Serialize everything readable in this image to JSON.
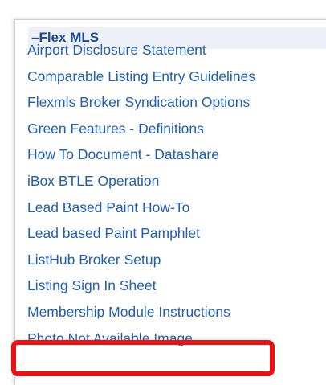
{
  "section": {
    "title": "–Flex MLS"
  },
  "documents": [
    {
      "label": "Airport Disclosure Statement"
    },
    {
      "label": "Comparable Listing Entry Guidelines"
    },
    {
      "label": "Flexmls Broker Syndication Options"
    },
    {
      "label": "Green Features - Definitions"
    },
    {
      "label": "How To Document - Datashare"
    },
    {
      "label": "iBox BTLE Operation"
    },
    {
      "label": "Lead Based Paint How-To"
    },
    {
      "label": "Lead based Paint Pamphlet"
    },
    {
      "label": "ListHub Broker Setup"
    },
    {
      "label": "Listing Sign In Sheet"
    },
    {
      "label": "Membership Module Instructions"
    },
    {
      "label": "Photo Not Available Image"
    }
  ],
  "colors": {
    "link": "#1f5fb5",
    "header_text": "#1a4b93",
    "header_bg": "#eef0f8",
    "highlight": "#ee1111"
  }
}
